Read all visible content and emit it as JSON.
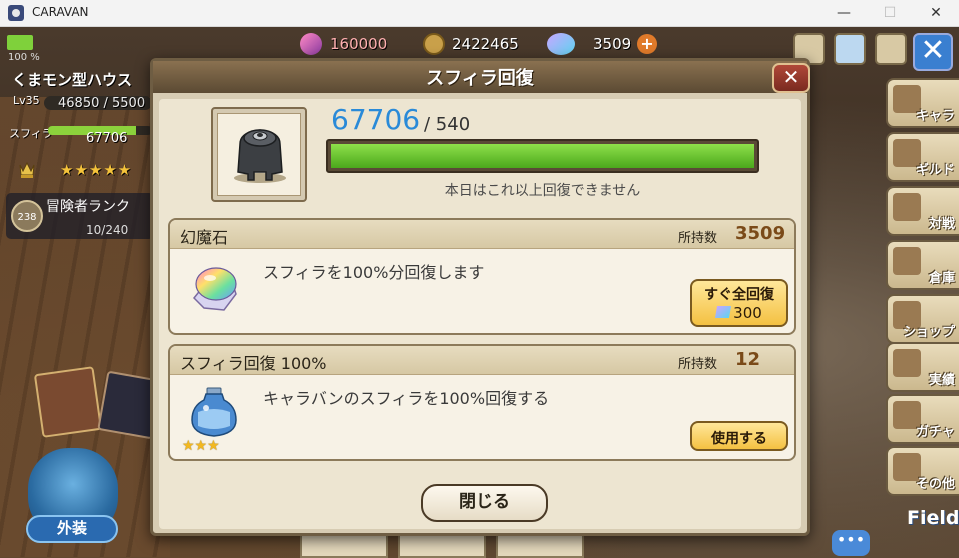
{
  "window": {
    "title": "CARAVAN",
    "controls": [
      "—",
      "☐",
      "✕"
    ]
  },
  "hud": {
    "battery_level": 1.0,
    "battery_pct": "100 %",
    "house_name": "くまモン型ハウス",
    "level": "Lv35",
    "exp": "46850 / 5500",
    "sphira_label": "スフィラ",
    "sphira_value": "67706",
    "sphira_fill": 0.85,
    "stars": "★★★★★",
    "rank_badge": "238",
    "rank_title": "冒険者ランク",
    "rank_progress": "10/240"
  },
  "resources": {
    "crystal": "160000",
    "coin": "2422465",
    "gem": "3509",
    "gem_add": "+"
  },
  "side_menu": [
    {
      "name": "side-chara",
      "label": "キャラ"
    },
    {
      "name": "side-guild",
      "label": "ギルド"
    },
    {
      "name": "side-battle",
      "label": "対戦"
    },
    {
      "name": "side-warehouse",
      "label": "倉庫"
    },
    {
      "name": "side-shop",
      "label": "ショップ"
    },
    {
      "name": "side-achievement",
      "label": "実績"
    },
    {
      "name": "side-gacha",
      "label": "ガチャ"
    },
    {
      "name": "side-other",
      "label": "その他"
    }
  ],
  "field_label": "Field",
  "chat_label": "•••",
  "appearance_label": "外装",
  "dialog": {
    "title": "スフィラ回復",
    "close_glyph": "✕",
    "current": "67706",
    "max": "/ 540",
    "gauge_fill": 1.0,
    "notice": "本日はこれ以上回復できません",
    "close_button": "閉じる"
  },
  "cards": [
    {
      "name": "幻魔石",
      "owned_label": "所持数",
      "owned": "3509",
      "desc": "スフィラを100%分回復します",
      "button": "すぐ全回復",
      "cost": "300"
    },
    {
      "name": "スフィラ回復 100%",
      "owned_label": "所持数",
      "owned": "12",
      "desc": "キャラバンのスフィラを100%回復する",
      "button": "使用する",
      "rarity": "★★★"
    }
  ]
}
